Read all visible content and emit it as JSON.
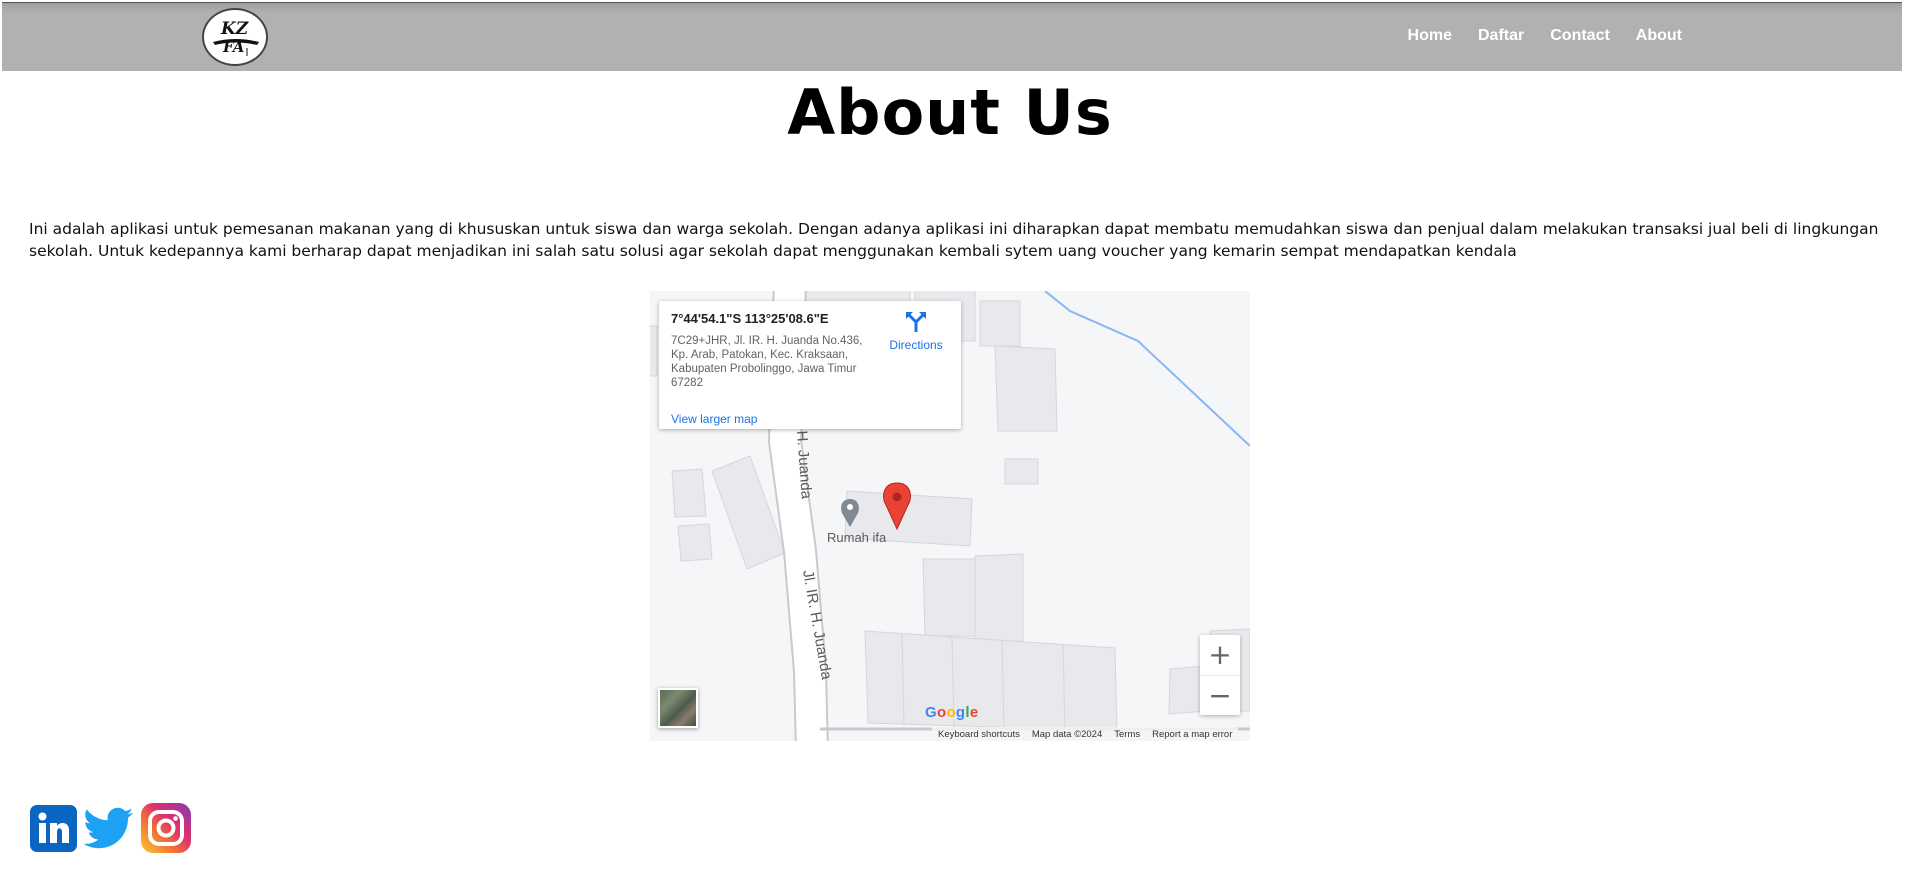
{
  "header": {
    "logo_text_top": "KZ",
    "logo_text_bottom": "FA",
    "nav": [
      {
        "label": "Home"
      },
      {
        "label": "Daftar"
      },
      {
        "label": "Contact"
      },
      {
        "label": "About"
      }
    ]
  },
  "main": {
    "title": "About Us",
    "description": "Ini adalah aplikasi untuk pemesanan makanan yang di khususkan untuk siswa dan warga sekolah. Dengan adanya aplikasi ini diharapkan dapat membatu memudahkan siswa dan penjual dalam melakukan transaksi jual beli di lingkungan sekolah. Untuk kedepannya kami berharap dapat menjadikan ini salah satu solusi agar sekolah dapat menggunakan kembali sytem uang voucher yang kemarin sempat mendapatkan kendala"
  },
  "map": {
    "coordinates": "7°44'54.1\"S 113°25'08.6\"E",
    "address": "7C29+JHR, Jl. IR. H. Juanda No.436, Kp. Arab, Patokan, Kec. Kraksaan, Kabupaten Probolinggo, Jawa Timur 67282",
    "directions_label": "Directions",
    "larger_map_label": "View larger map",
    "street_label_upper": "H. Juanda",
    "street_label_lower": "Jl. IR. H. Juanda",
    "poi_label": "Rumah ifa",
    "zoom_in": "+",
    "zoom_out": "−",
    "google_logo": {
      "letters": [
        "G",
        "o",
        "o",
        "g",
        "l",
        "e"
      ],
      "colors": [
        "#4285F4",
        "#EA4335",
        "#FBBC05",
        "#4285F4",
        "#34A853",
        "#EA4335"
      ]
    },
    "attribution": {
      "shortcuts": "Keyboard shortcuts",
      "map_data": "Map data ©2024",
      "terms": "Terms",
      "report": "Report a map error"
    },
    "colors": {
      "road": "#ffffff",
      "road_edge": "#c8cacd",
      "building": "#e8e9ec",
      "water_line": "#8ab4f8",
      "marker": "#ea4335"
    }
  },
  "social": [
    {
      "name": "LinkedIn",
      "icon": "linkedin-icon",
      "color": "#0a66c2"
    },
    {
      "name": "Twitter",
      "icon": "twitter-icon",
      "color": "#1da1f2"
    },
    {
      "name": "Instagram",
      "icon": "instagram-icon",
      "color": "#e1306c"
    }
  ]
}
